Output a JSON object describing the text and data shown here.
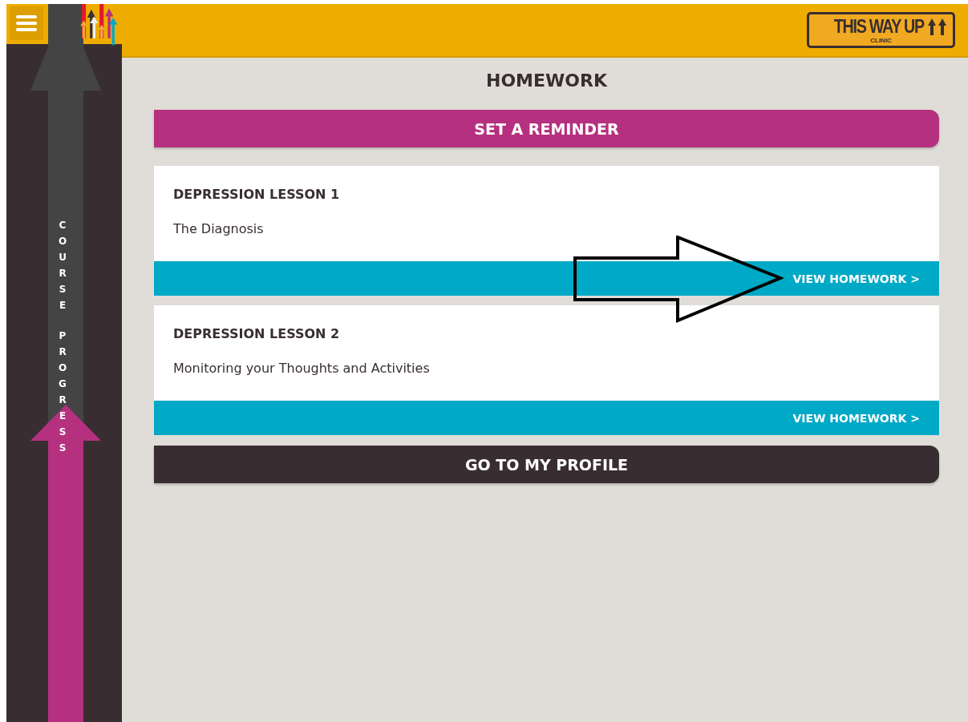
{
  "sidebar": {
    "progress_label": "COURSE PROGRESS"
  },
  "logo": {
    "title": "THIS WAY UP",
    "subtitle": "CLINIC"
  },
  "page_title": "HOMEWORK",
  "reminder_button": "SET A REMINDER",
  "lessons": [
    {
      "title": "DEPRESSION LESSON 1",
      "subtitle": "The Diagnosis",
      "link": "VIEW HOMEWORK >"
    },
    {
      "title": "DEPRESSION LESSON 2",
      "subtitle": "Monitoring your Thoughts and Activities",
      "link": "VIEW HOMEWORK >"
    }
  ],
  "profile_button": "GO TO MY PROFILE"
}
